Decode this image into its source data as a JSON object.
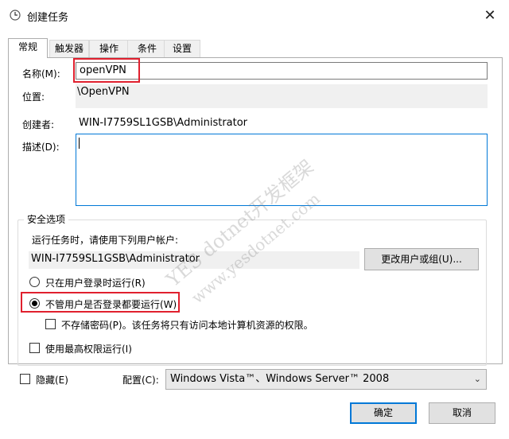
{
  "window": {
    "title": "创建任务",
    "close_glyph": "✕"
  },
  "tabs": [
    "常规",
    "触发器",
    "操作",
    "条件",
    "设置"
  ],
  "general": {
    "name_label": "名称(M):",
    "name_value": "openVPN",
    "location_label": "位置:",
    "location_value": "\\OpenVPN",
    "author_label": "创建者:",
    "author_value": "WIN-I7759SL1GSB\\Administrator",
    "description_label": "描述(D):",
    "description_value": ""
  },
  "security": {
    "group_title": "安全选项",
    "run_as_label": "运行任务时，请使用下列用户帐户:",
    "run_as_value": "WIN-I7759SL1GSB\\Administrator",
    "change_user_button": "更改用户或组(U)...",
    "radio_logged_on": "只在用户登录时运行(R)",
    "radio_whether_logged_on": "不管用户是否登录都要运行(W)",
    "selected_radio": "radio_whether_logged_on",
    "do_not_store_password": "不存储密码(P)。该任务将只有访问本地计算机资源的权限。",
    "highest_privileges": "使用最高权限运行(I)"
  },
  "footer": {
    "hidden_label": "隐藏(E)",
    "configure_label": "配置(C):",
    "configure_value": "Windows Vista™、Windows Server™ 2008",
    "ok_button": "确定",
    "cancel_button": "取消"
  },
  "watermark": {
    "line1": "YES dotnet开发框架",
    "line2": "www.yesdotnet.com"
  },
  "colors": {
    "highlight": "#e0202e",
    "focus_border": "#0078d7",
    "readonly_bg": "#f0f0f0"
  },
  "icons": {
    "app": "task-clock-icon",
    "dropdown": "chevron-down-icon"
  }
}
